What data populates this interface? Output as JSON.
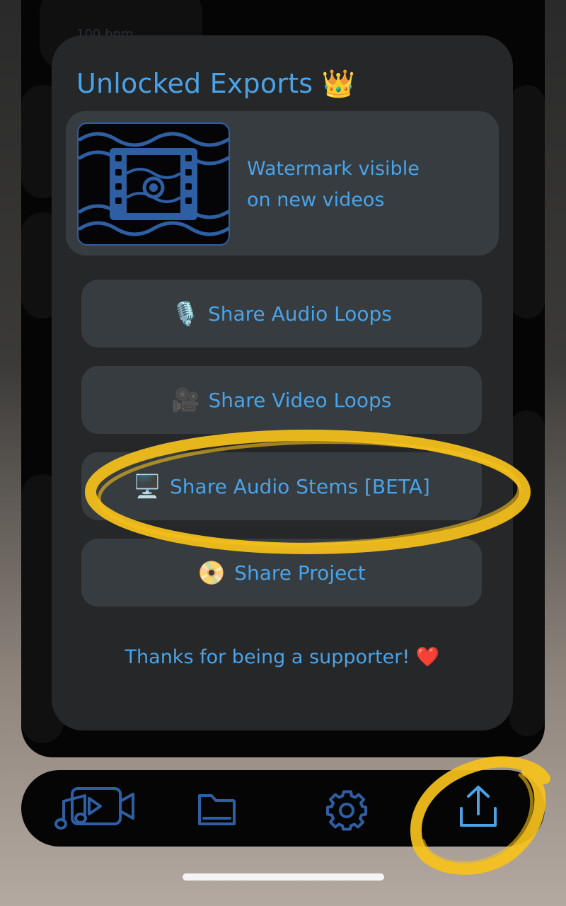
{
  "background": {
    "tempo_text": "100 bpm"
  },
  "sheet": {
    "title": "Unlocked Exports",
    "title_emoji": "👑",
    "banner": {
      "icon": "watermark-film-icon",
      "line1": "Watermark visible",
      "line2": "on new videos"
    },
    "actions": [
      {
        "emoji": "🎙️",
        "label": "Share Audio Loops"
      },
      {
        "emoji": "🎥",
        "label": "Share Video Loops"
      },
      {
        "emoji": "🖥️",
        "label": "Share Audio Stems [BETA]"
      },
      {
        "emoji": "📀",
        "label": "Share Project"
      }
    ],
    "thanks": "Thanks for being a supporter!",
    "thanks_emoji": "❤️"
  },
  "tabbar": {
    "tabs": [
      {
        "icon": "music-video-icon"
      },
      {
        "icon": "folder-icon"
      },
      {
        "icon": "gear-icon"
      },
      {
        "icon": "share-icon"
      }
    ]
  },
  "colors": {
    "accent": "#4aa3e8",
    "sheet": "#262728",
    "button": "#363c3f",
    "highlight": "#f7c21b"
  }
}
